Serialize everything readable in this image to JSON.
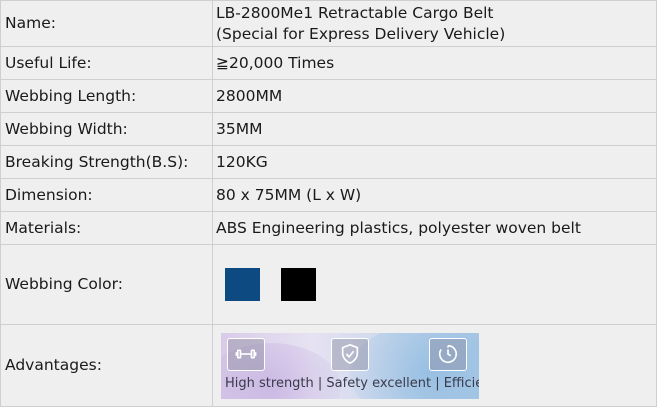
{
  "rows": {
    "name": {
      "label": "Name:",
      "value_line1": "LB-2800Me1 Retractable Cargo Belt",
      "value_line2": "(Special for Express Delivery Vehicle)"
    },
    "life": {
      "label": "Useful Life:",
      "value": "≧20,000 Times"
    },
    "length": {
      "label": "Webbing Length:",
      "value": "2800MM"
    },
    "width": {
      "label": "Webbing Width:",
      "value": "35MM"
    },
    "strength": {
      "label": "Breaking Strength(B.S):",
      "value": "120KG"
    },
    "dimension": {
      "label": "Dimension:",
      "value": "80 x 75MM (L x W)"
    },
    "materials": {
      "label": "Materials:",
      "value": "ABS Engineering plastics, polyester woven belt"
    },
    "color": {
      "label": "Webbing Color:",
      "swatches": [
        "#0d4a82",
        "#000000"
      ]
    },
    "advantages": {
      "label": "Advantages:",
      "icons": [
        "dumbbell-icon",
        "shield-check-icon",
        "timer-icon"
      ],
      "caption": "High strength | Safety excellent | Efficient"
    }
  }
}
